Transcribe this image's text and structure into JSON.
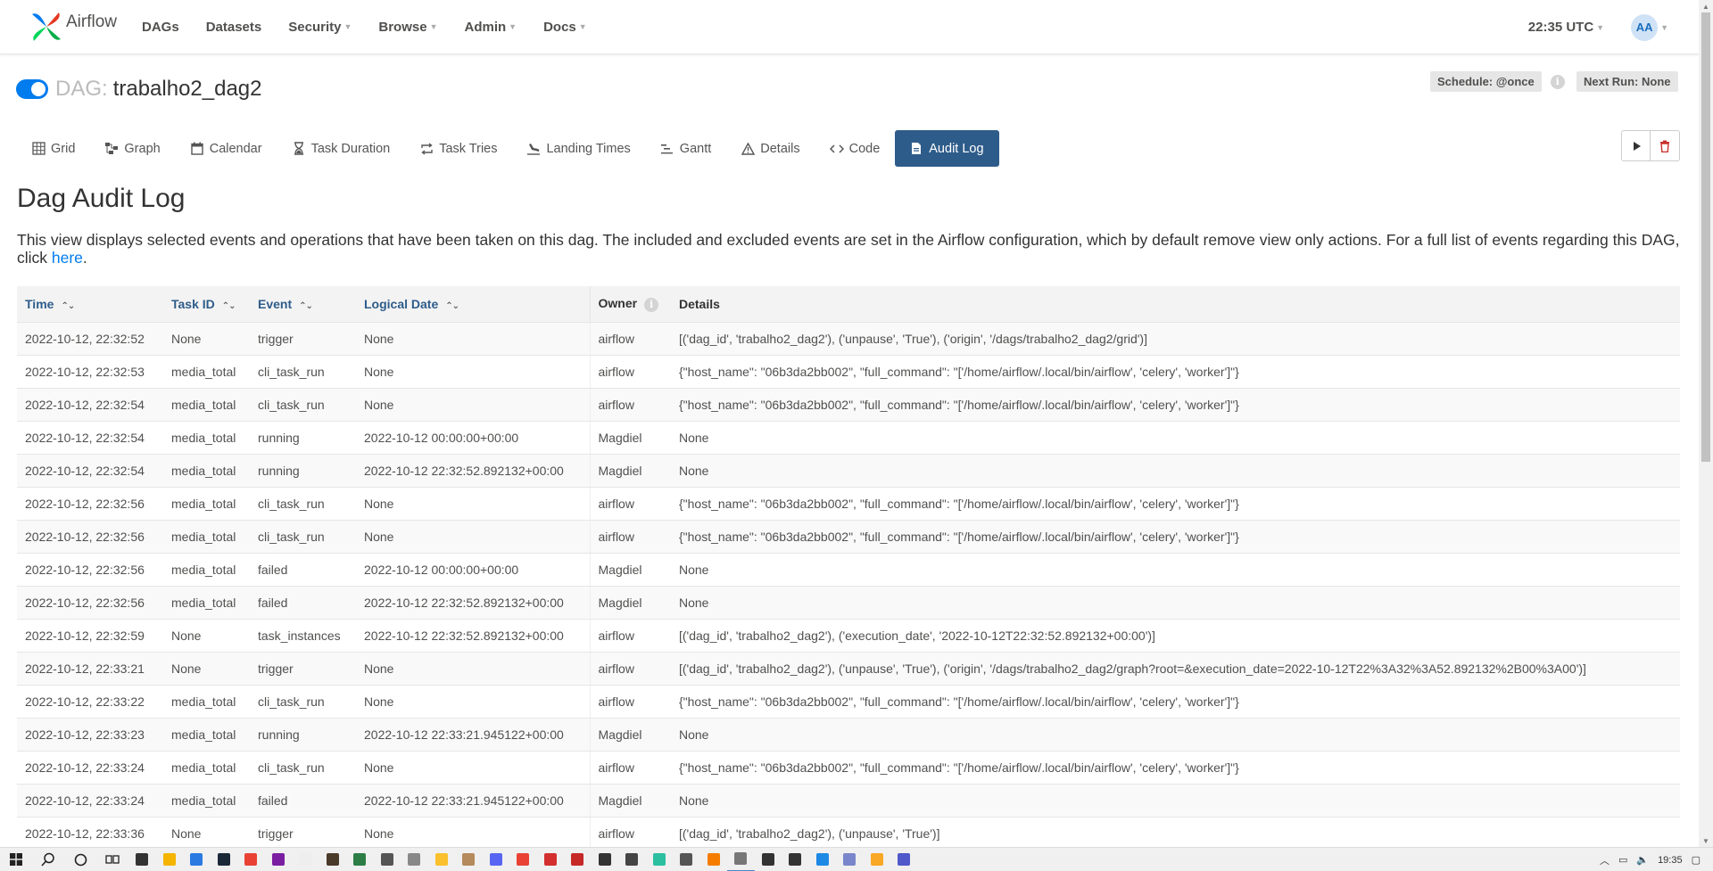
{
  "navbar": {
    "brand": "Airflow",
    "menu": [
      {
        "label": "DAGs",
        "dropdown": false
      },
      {
        "label": "Datasets",
        "dropdown": false
      },
      {
        "label": "Security",
        "dropdown": true
      },
      {
        "label": "Browse",
        "dropdown": true
      },
      {
        "label": "Admin",
        "dropdown": true
      },
      {
        "label": "Docs",
        "dropdown": true
      }
    ],
    "clock": "22:35 UTC",
    "avatar": "AA"
  },
  "dag": {
    "prefix": "DAG:",
    "name": "trabalho2_dag2",
    "paused": false,
    "schedule": "Schedule: @once",
    "next_run": "Next Run: None"
  },
  "tabs": [
    {
      "label": "Grid",
      "icon": "grid-icon",
      "active": false
    },
    {
      "label": "Graph",
      "icon": "graph-icon",
      "active": false
    },
    {
      "label": "Calendar",
      "icon": "calendar-icon",
      "active": false
    },
    {
      "label": "Task Duration",
      "icon": "hourglass-icon",
      "active": false
    },
    {
      "label": "Task Tries",
      "icon": "retry-icon",
      "active": false
    },
    {
      "label": "Landing Times",
      "icon": "landing-icon",
      "active": false
    },
    {
      "label": "Gantt",
      "icon": "gantt-icon",
      "active": false
    },
    {
      "label": "Details",
      "icon": "warning-icon",
      "active": false
    },
    {
      "label": "Code",
      "icon": "code-icon",
      "active": false
    },
    {
      "label": "Audit Log",
      "icon": "document-icon",
      "active": true
    }
  ],
  "page": {
    "title": "Dag Audit Log",
    "description": "This view displays selected events and operations that have been taken on this dag. The included and excluded events are set in the Airflow configuration, which by default remove view only actions. For a full list of events regarding this DAG, click ",
    "link_text": "here",
    "description_end": "."
  },
  "table": {
    "columns": [
      "Time",
      "Task ID",
      "Event",
      "Logical Date",
      "Owner",
      "Details"
    ],
    "rows": [
      [
        "2022-10-12, 22:32:52",
        "None",
        "trigger",
        "None",
        "airflow",
        "[('dag_id', 'trabalho2_dag2'), ('unpause', 'True'), ('origin', '/dags/trabalho2_dag2/grid')]"
      ],
      [
        "2022-10-12, 22:32:53",
        "media_total",
        "cli_task_run",
        "None",
        "airflow",
        "{\"host_name\": \"06b3da2bb002\", \"full_command\": \"['/home/airflow/.local/bin/airflow', 'celery', 'worker']\"}"
      ],
      [
        "2022-10-12, 22:32:54",
        "media_total",
        "cli_task_run",
        "None",
        "airflow",
        "{\"host_name\": \"06b3da2bb002\", \"full_command\": \"['/home/airflow/.local/bin/airflow', 'celery', 'worker']\"}"
      ],
      [
        "2022-10-12, 22:32:54",
        "media_total",
        "running",
        "2022-10-12 00:00:00+00:00",
        "Magdiel",
        "None"
      ],
      [
        "2022-10-12, 22:32:54",
        "media_total",
        "running",
        "2022-10-12 22:32:52.892132+00:00",
        "Magdiel",
        "None"
      ],
      [
        "2022-10-12, 22:32:56",
        "media_total",
        "cli_task_run",
        "None",
        "airflow",
        "{\"host_name\": \"06b3da2bb002\", \"full_command\": \"['/home/airflow/.local/bin/airflow', 'celery', 'worker']\"}"
      ],
      [
        "2022-10-12, 22:32:56",
        "media_total",
        "cli_task_run",
        "None",
        "airflow",
        "{\"host_name\": \"06b3da2bb002\", \"full_command\": \"['/home/airflow/.local/bin/airflow', 'celery', 'worker']\"}"
      ],
      [
        "2022-10-12, 22:32:56",
        "media_total",
        "failed",
        "2022-10-12 00:00:00+00:00",
        "Magdiel",
        "None"
      ],
      [
        "2022-10-12, 22:32:56",
        "media_total",
        "failed",
        "2022-10-12 22:32:52.892132+00:00",
        "Magdiel",
        "None"
      ],
      [
        "2022-10-12, 22:32:59",
        "None",
        "task_instances",
        "2022-10-12 22:32:52.892132+00:00",
        "airflow",
        "[('dag_id', 'trabalho2_dag2'), ('execution_date', '2022-10-12T22:32:52.892132+00:00')]"
      ],
      [
        "2022-10-12, 22:33:21",
        "None",
        "trigger",
        "None",
        "airflow",
        "[('dag_id', 'trabalho2_dag2'), ('unpause', 'True'), ('origin', '/dags/trabalho2_dag2/graph?root=&execution_date=2022-10-12T22%3A32%3A52.892132%2B00%3A00')]"
      ],
      [
        "2022-10-12, 22:33:22",
        "media_total",
        "cli_task_run",
        "None",
        "airflow",
        "{\"host_name\": \"06b3da2bb002\", \"full_command\": \"['/home/airflow/.local/bin/airflow', 'celery', 'worker']\"}"
      ],
      [
        "2022-10-12, 22:33:23",
        "media_total",
        "running",
        "2022-10-12 22:33:21.945122+00:00",
        "Magdiel",
        "None"
      ],
      [
        "2022-10-12, 22:33:24",
        "media_total",
        "cli_task_run",
        "None",
        "airflow",
        "{\"host_name\": \"06b3da2bb002\", \"full_command\": \"['/home/airflow/.local/bin/airflow', 'celery', 'worker']\"}"
      ],
      [
        "2022-10-12, 22:33:24",
        "media_total",
        "failed",
        "2022-10-12 22:33:21.945122+00:00",
        "Magdiel",
        "None"
      ],
      [
        "2022-10-12, 22:33:36",
        "None",
        "trigger",
        "None",
        "airflow",
        "[('dag_id', 'trabalho2_dag2'), ('unpause', 'True')]"
      ]
    ]
  },
  "taskbar": {
    "time": "19:35"
  },
  "colors": {
    "accent": "#017cee",
    "active_tab": "#2e5c8a",
    "header_bg": "#f3f3f3"
  }
}
